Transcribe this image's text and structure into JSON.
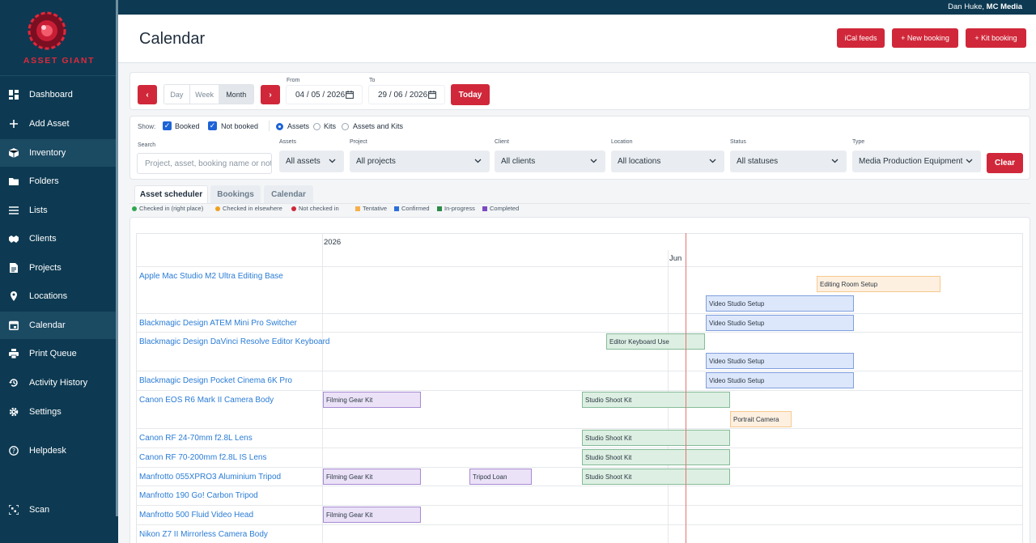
{
  "brand": {
    "wordmark": "ASSET GIANT"
  },
  "topbar": {
    "user_name": "Dan Huke, ",
    "org": "MC Media"
  },
  "sidebar": {
    "items": [
      {
        "label": "Dashboard",
        "icon": "dashboard-icon"
      },
      {
        "label": "Add Asset",
        "icon": "plus-icon"
      },
      {
        "label": "Inventory",
        "icon": "box-icon"
      },
      {
        "label": "Folders",
        "icon": "folder-icon"
      },
      {
        "label": "Lists",
        "icon": "list-icon"
      },
      {
        "label": "Clients",
        "icon": "handshake-icon"
      },
      {
        "label": "Projects",
        "icon": "document-icon"
      },
      {
        "label": "Locations",
        "icon": "map-pin-icon"
      },
      {
        "label": "Calendar",
        "icon": "calendar-icon",
        "active": true
      },
      {
        "label": "Print Queue",
        "icon": "printer-icon"
      },
      {
        "label": "Activity History",
        "icon": "history-icon"
      },
      {
        "label": "Settings",
        "icon": "gear-icon"
      },
      {
        "label": "Helpdesk",
        "icon": "help-icon"
      },
      {
        "label": "Scan",
        "icon": "scan-icon"
      }
    ]
  },
  "header": {
    "title": "Calendar",
    "buttons": {
      "ical": "iCal feeds",
      "new_booking": "+ New booking",
      "kit_booking": "+ Kit booking"
    }
  },
  "range": {
    "prev": "‹",
    "next": "›",
    "views": [
      "Day",
      "Week",
      "Month"
    ],
    "active_view": "Month",
    "from_label": "From",
    "from_value": "04 / 05 / 2026",
    "to_label": "To",
    "to_value": "29 / 06 / 2026",
    "today": "Today"
  },
  "filters": {
    "show_label": "Show:",
    "booked": "Booked",
    "not_booked": "Not booked",
    "scope": [
      "Assets",
      "Kits",
      "Assets and Kits"
    ],
    "scope_selected": "Assets",
    "search_label": "Search",
    "search_placeholder": "Project, asset, booking name or note",
    "assets_label": "Assets",
    "assets_value": "All assets",
    "project_label": "Project",
    "project_value": "All projects",
    "client_label": "Client",
    "client_value": "All clients",
    "location_label": "Location",
    "location_value": "All locations",
    "status_label": "Status",
    "status_value": "All statuses",
    "type_label": "Type",
    "type_value": "Media Production Equipment",
    "clear": "Clear"
  },
  "tabs": [
    "Asset scheduler",
    "Bookings",
    "Calendar"
  ],
  "active_tab": "Asset scheduler",
  "legend": [
    {
      "label": "Checked in (right place)",
      "color": "#2fa84f",
      "shape": "dot"
    },
    {
      "label": "Checked in elsewhere",
      "color": "#f0a020",
      "shape": "dot"
    },
    {
      "label": "Not checked in",
      "color": "#d0283a",
      "shape": "dot"
    },
    {
      "label": "Tentative",
      "color": "#f6b04c",
      "shape": "square"
    },
    {
      "label": "Confirmed",
      "color": "#2d6fd8",
      "shape": "square"
    },
    {
      "label": "In-progress",
      "color": "#2c8a4a",
      "shape": "square"
    },
    {
      "label": "Completed",
      "color": "#7b4bc2",
      "shape": "square"
    }
  ],
  "scheduler": {
    "year": "2026",
    "month": "Jun",
    "rows": [
      {
        "asset": "Apple Mac Studio M2 Ultra Editing Base",
        "lanes": 2,
        "bookings": [
          {
            "label": "Editing Room Setup",
            "lane": 0,
            "status": "tentative"
          },
          {
            "label": "Video Studio Setup",
            "lane": 1,
            "status": "confirmed"
          }
        ]
      },
      {
        "asset": "Blackmagic Design ATEM Mini Pro Switcher",
        "lanes": 1,
        "bookings": [
          {
            "label": "Video Studio Setup",
            "lane": 0,
            "status": "confirmed"
          }
        ]
      },
      {
        "asset": "Blackmagic Design DaVinci Resolve Editor Keyboard",
        "lanes": 2,
        "bookings": [
          {
            "label": "Editor Keyboard Use",
            "lane": 0,
            "status": "in-progress"
          },
          {
            "label": "Video Studio Setup",
            "lane": 1,
            "status": "confirmed"
          }
        ]
      },
      {
        "asset": "Blackmagic Design Pocket Cinema 6K Pro",
        "lanes": 1,
        "bookings": [
          {
            "label": "Video Studio Setup",
            "lane": 0,
            "status": "confirmed"
          }
        ]
      },
      {
        "asset": "Canon EOS R6 Mark II Camera Body",
        "lanes": 2,
        "bookings": [
          {
            "label": "Filming Gear Kit",
            "lane": 0,
            "status": "completed"
          },
          {
            "label": "Studio Shoot Kit",
            "lane": 0,
            "status": "in-progress"
          },
          {
            "label": "Portrait Camera",
            "lane": 1,
            "status": "tentative"
          }
        ]
      },
      {
        "asset": "Canon RF 24-70mm f2.8L Lens",
        "lanes": 1,
        "bookings": [
          {
            "label": "Studio Shoot Kit",
            "lane": 0,
            "status": "in-progress"
          }
        ]
      },
      {
        "asset": "Canon RF 70-200mm f2.8L IS Lens",
        "lanes": 1,
        "bookings": [
          {
            "label": "Studio Shoot Kit",
            "lane": 0,
            "status": "in-progress"
          }
        ]
      },
      {
        "asset": "Manfrotto 055XPRO3 Aluminium Tripod",
        "lanes": 1,
        "bookings": [
          {
            "label": "Filming Gear Kit",
            "lane": 0,
            "status": "completed"
          },
          {
            "label": "Tripod Loan",
            "lane": 0,
            "status": "completed"
          },
          {
            "label": "Studio Shoot Kit",
            "lane": 0,
            "status": "in-progress"
          }
        ]
      },
      {
        "asset": "Manfrotto 190 Go! Carbon Tripod",
        "lanes": 1,
        "bookings": []
      },
      {
        "asset": "Manfrotto 500 Fluid Video Head",
        "lanes": 1,
        "bookings": [
          {
            "label": "Filming Gear Kit",
            "lane": 0,
            "status": "completed"
          }
        ]
      },
      {
        "asset": "Nikon Z7 II Mirrorless Camera Body",
        "lanes": 1,
        "bookings": []
      }
    ]
  }
}
